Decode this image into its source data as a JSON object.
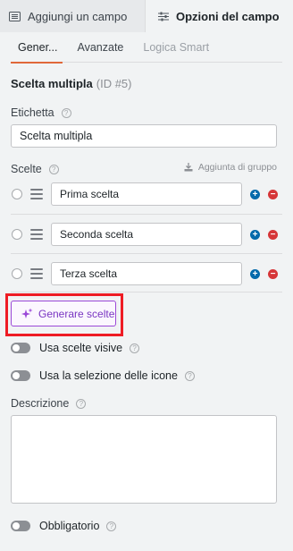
{
  "top_tabs": [
    {
      "label": "Aggiungi un campo",
      "icon": "list-icon"
    },
    {
      "label": "Opzioni del campo",
      "icon": "sliders-icon"
    }
  ],
  "sub_tabs": [
    {
      "label": "Gener..."
    },
    {
      "label": "Avanzate"
    },
    {
      "label": "Logica Smart"
    }
  ],
  "field": {
    "name": "Scelta multipla",
    "id_text": "(ID #5)"
  },
  "label_field": {
    "label": "Etichetta",
    "value": "Scelta multipla"
  },
  "choices": {
    "label": "Scelte",
    "bulk_label": "Aggiunta di gruppo",
    "items": [
      {
        "label": "Prima scelta"
      },
      {
        "label": "Seconda scelta"
      },
      {
        "label": "Terza scelta"
      }
    ]
  },
  "generate_button": {
    "label": "Generare scelte"
  },
  "toggles": {
    "visual": "Usa scelte visive",
    "icons": "Usa la selezione delle icone",
    "required": "Obbligatorio"
  },
  "description": {
    "label": "Descrizione",
    "value": ""
  },
  "colors": {
    "accent": "#e0683a",
    "add": "#036aab",
    "remove": "#d63638",
    "ai": "#7a36c2",
    "highlight": "#ee1c24"
  }
}
